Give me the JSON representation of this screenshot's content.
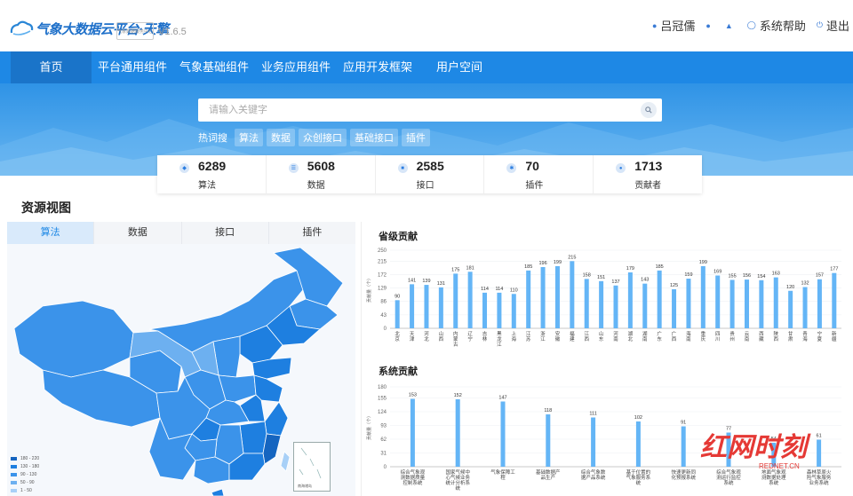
{
  "header": {
    "logo_text": "气象大数据云平台·天擎",
    "logo_badge": "气象数据服务中心",
    "version": "V1.6.5",
    "user_name": "吕冠儒",
    "help_label": "系统帮助",
    "logout_label": "退出"
  },
  "nav": {
    "items": [
      {
        "label": "首页",
        "active": true
      },
      {
        "label": "平台通用组件"
      },
      {
        "label": "气象基础组件"
      },
      {
        "label": "业务应用组件"
      },
      {
        "label": "应用开发框架"
      },
      {
        "label": "用户空间"
      }
    ]
  },
  "search": {
    "placeholder": "请输入关键字",
    "value": ""
  },
  "hot": {
    "label": "热词搜",
    "tags": [
      "算法",
      "数据",
      "众创接口",
      "基础接口",
      "插件"
    ]
  },
  "stats": [
    {
      "value": "6289",
      "label": "算法",
      "icon": "algorithm-icon"
    },
    {
      "value": "5608",
      "label": "数据",
      "icon": "database-icon"
    },
    {
      "value": "2585",
      "label": "接口",
      "icon": "interface-icon"
    },
    {
      "value": "70",
      "label": "插件",
      "icon": "plugin-icon"
    },
    {
      "value": "1713",
      "label": "贡献者",
      "icon": "user-icon"
    }
  ],
  "resource_view": {
    "title": "资源视图",
    "tabs": [
      {
        "label": "算法",
        "active": true
      },
      {
        "label": "数据"
      },
      {
        "label": "接口"
      },
      {
        "label": "插件"
      }
    ],
    "legend": [
      {
        "label": "180 - 220",
        "color": "#1565c0"
      },
      {
        "label": "130 - 180",
        "color": "#1e7fe0"
      },
      {
        "label": "90 - 130",
        "color": "#3b93ea"
      },
      {
        "label": "50 - 90",
        "color": "#6db0f0"
      },
      {
        "label": "1 - 50",
        "color": "#a8d0f7"
      }
    ],
    "south_sea_label": "南海诸岛"
  },
  "colors": {
    "nav_bg": "#1e88e5",
    "bar": "#64b5f6",
    "accent": "#1e88e5"
  },
  "chart_data": [
    {
      "type": "bar",
      "title": "省级贡献",
      "ylabel": "贡献量（个）",
      "ylim": [
        0,
        250
      ],
      "yticks": [
        0,
        43,
        86,
        129,
        172,
        215,
        250
      ],
      "categories": [
        "北京",
        "天津",
        "河北",
        "山西",
        "内蒙古",
        "辽宁",
        "吉林",
        "黑龙江",
        "上海",
        "江苏",
        "浙江",
        "安徽",
        "福建",
        "江西",
        "山东",
        "河南",
        "湖北",
        "湖南",
        "广东",
        "广西",
        "海南",
        "重庆",
        "四川",
        "贵州",
        "云南",
        "西藏",
        "陕西",
        "甘肃",
        "青海",
        "宁夏",
        "新疆"
      ],
      "values": [
        90,
        141,
        139,
        131,
        175,
        181,
        114,
        114,
        110,
        185,
        196,
        199,
        215,
        158,
        151,
        137,
        179,
        143,
        185,
        125,
        159,
        199,
        169,
        155,
        156,
        154,
        163,
        120,
        132,
        157,
        177
      ]
    },
    {
      "type": "bar",
      "title": "系统贡献",
      "ylabel": "贡献量（个）",
      "ylim": [
        0,
        180
      ],
      "yticks": [
        0,
        31,
        62,
        93,
        124,
        155,
        180
      ],
      "categories": [
        "综合气象观测数据质量控制系统",
        "国家气候中心气候业务统计分析系统",
        "气象保障工程",
        "基础数据产品生产",
        "综合气象数据产品系统",
        "基于位置的气象服务系统",
        "快速更新同化预报系统",
        "综合气象观测运行监控系统",
        "地面气象观测数据处理系统",
        "森林草原火险气象服务业务系统"
      ],
      "values": [
        153,
        152,
        147,
        118,
        111,
        102,
        91,
        77,
        54,
        61
      ]
    }
  ],
  "watermark": {
    "text": "红网时刻",
    "sub": "REDNET.CN"
  }
}
